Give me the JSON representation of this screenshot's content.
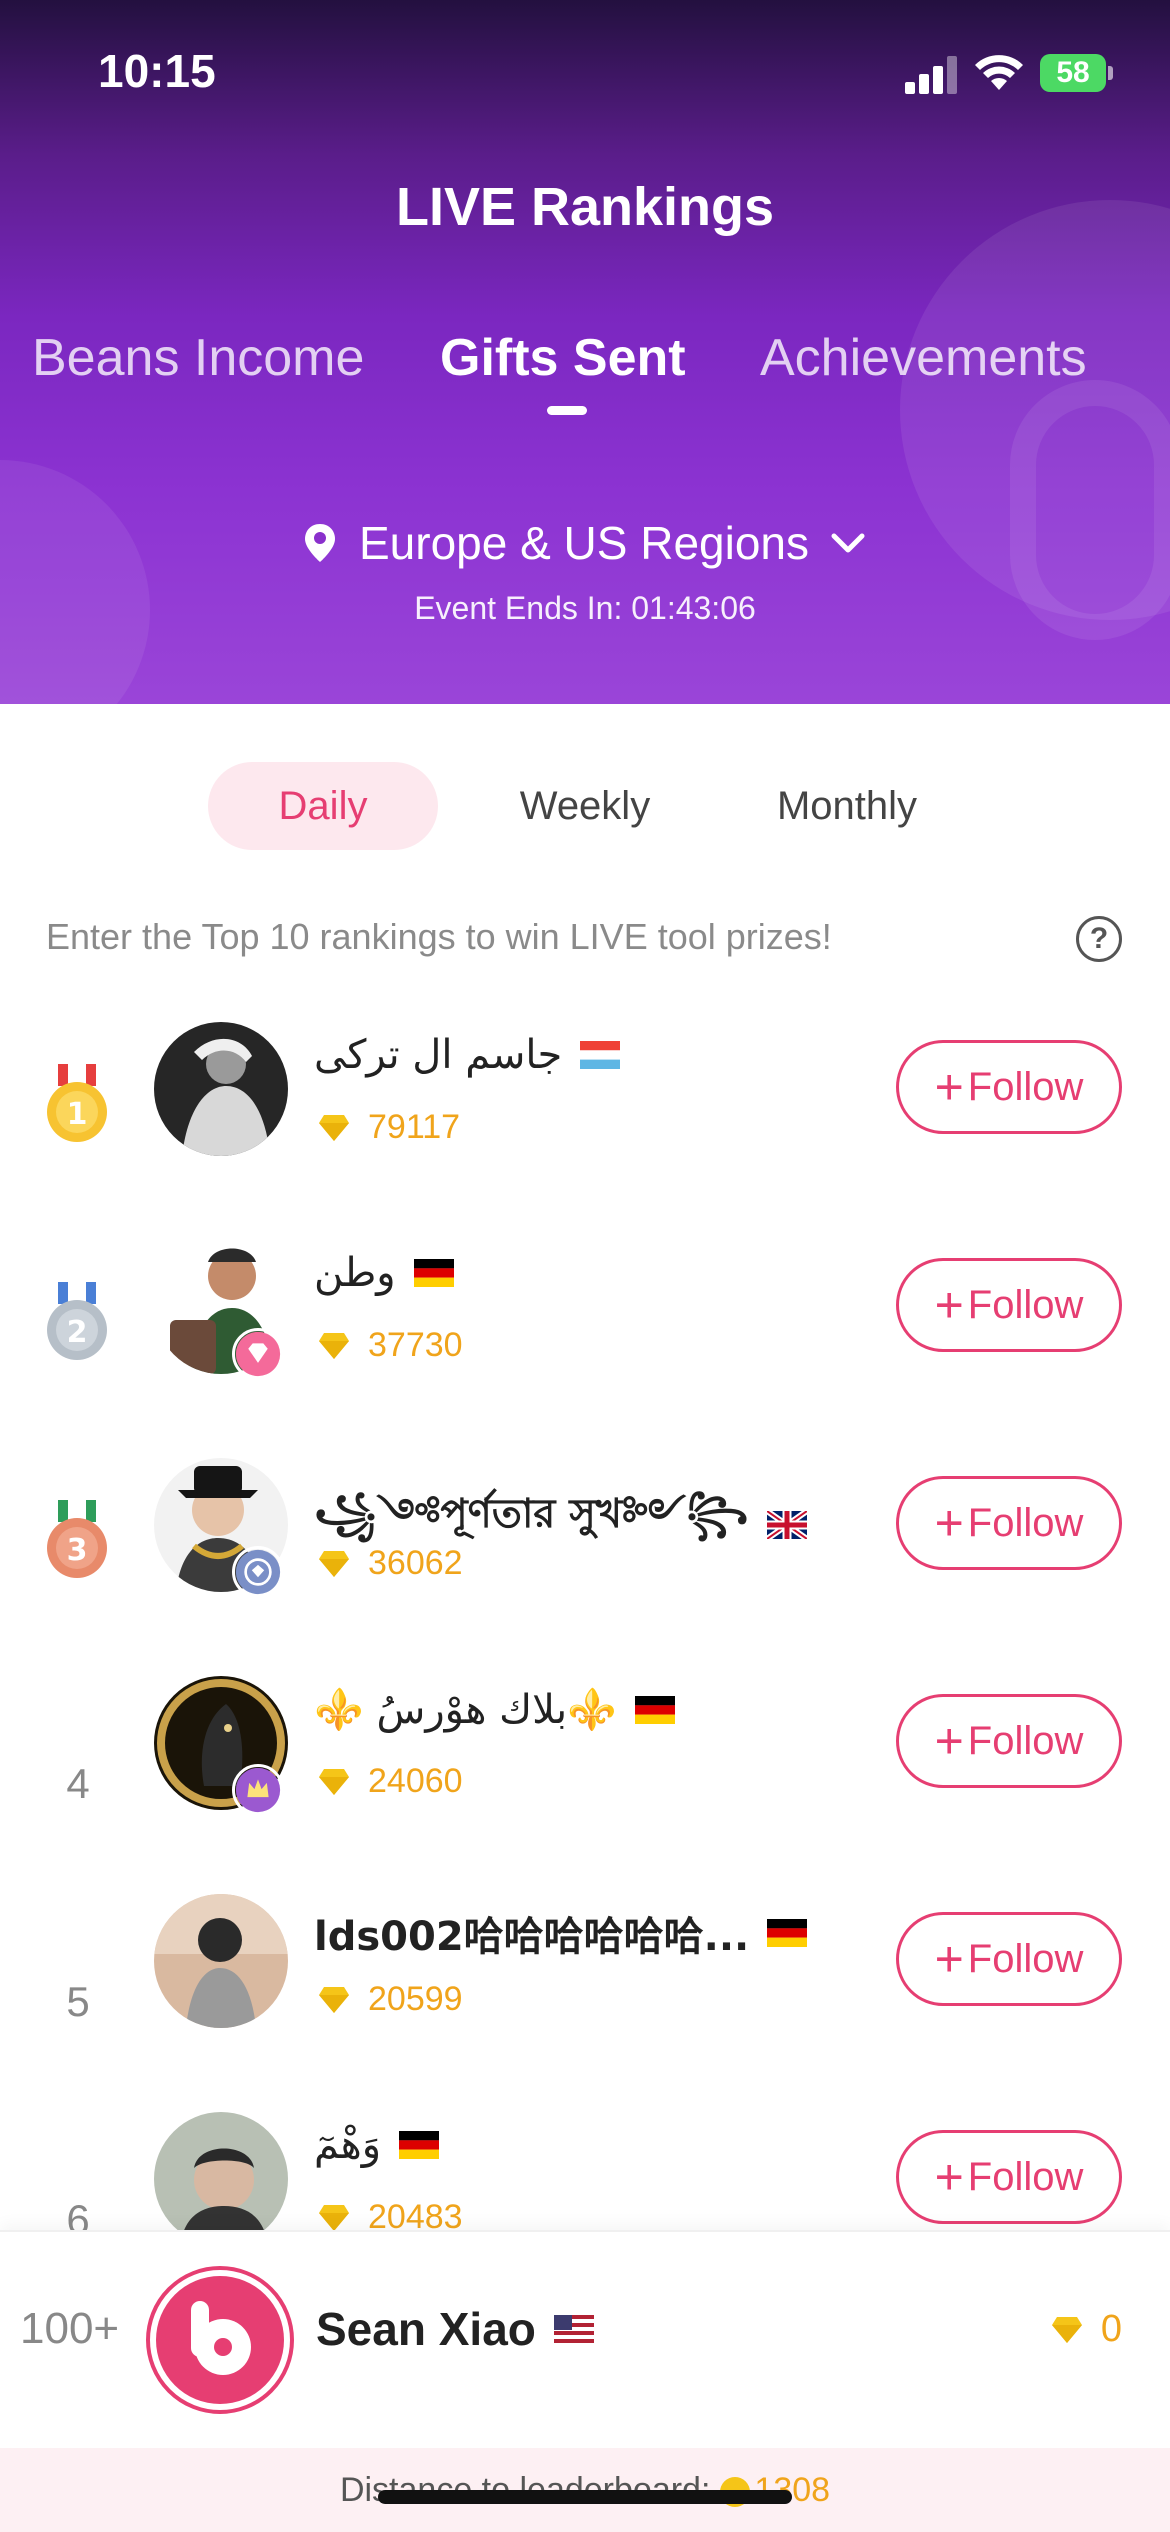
{
  "status_bar": {
    "time": "10:15",
    "battery": "58"
  },
  "header": {
    "title": "LIVE Rankings",
    "tabs": [
      "Beans Income",
      "Gifts Sent",
      "Achievements"
    ],
    "active_tab": "Gifts Sent",
    "region": "Europe & US Regions",
    "event_ends": "Event Ends In: 01:43:06"
  },
  "periods": {
    "items": [
      "Daily",
      "Weekly",
      "Monthly"
    ],
    "active": "Daily"
  },
  "hint": "Enter the Top 10 rankings to win LIVE tool prizes!",
  "follow_label": "Follow",
  "rankings": [
    {
      "rank": "1",
      "name": "جاسم ال ترکی",
      "score": "79117",
      "flag": "luxembourg"
    },
    {
      "rank": "2",
      "name": "وطن",
      "score": "37730",
      "flag": "germany"
    },
    {
      "rank": "3",
      "name": "꧁༺পূর্ণতার সুখ༻꧂",
      "score": "36062",
      "flag": "united-kingdom"
    },
    {
      "rank": "4",
      "name": "⚜️ بلاك هوْرسُ⚜️",
      "score": "24060",
      "flag": "germany"
    },
    {
      "rank": "5",
      "name": "lds002哈哈哈哈哈哈...",
      "score": "20599",
      "flag": "germany"
    },
    {
      "rank": "6",
      "name": "وَهْمٓ",
      "score": "20483",
      "flag": "germany"
    }
  ],
  "me": {
    "rank": "100+",
    "name": "Sean Xiao",
    "score": "0",
    "flag": "united-states"
  },
  "distance": {
    "label": "Distance to leaderboard:",
    "value": "1308"
  },
  "colors": {
    "accent": "#e63e72",
    "gold": "#f0a41b",
    "header_purple": "#8c33d2"
  }
}
